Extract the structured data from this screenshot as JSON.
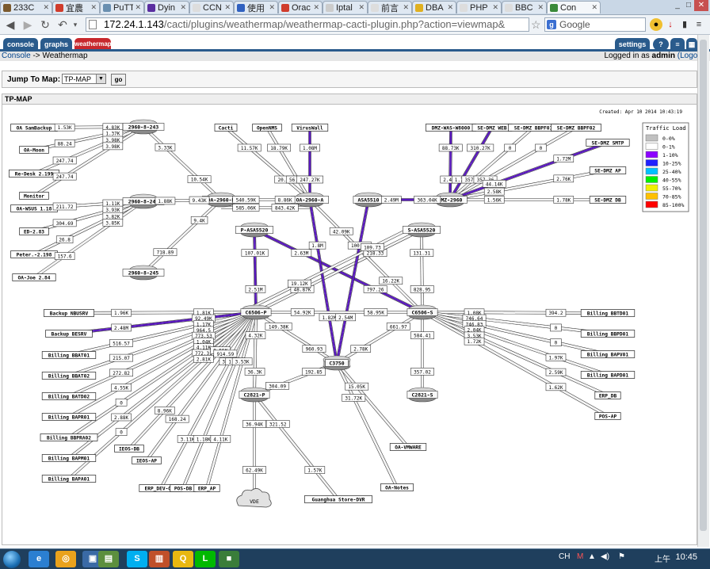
{
  "browser": {
    "tabs": [
      {
        "title": "233C",
        "color": "#7b5a2e"
      },
      {
        "title": "宜農",
        "color": "#d03c2c"
      },
      {
        "title": "PuTT",
        "color": "#6a8fb0"
      },
      {
        "title": "Dyin",
        "color": "#5a2ea0"
      },
      {
        "title": "CCN",
        "color": "#dddddd"
      },
      {
        "title": "使用",
        "color": "#3061c0"
      },
      {
        "title": "Orac",
        "color": "#d03c2c"
      },
      {
        "title": "Iptal",
        "color": "#cccccc"
      },
      {
        "title": "前言",
        "color": "#dddddd"
      },
      {
        "title": "DBA",
        "color": "#e0b020"
      },
      {
        "title": "PHP",
        "color": "#dddddd"
      },
      {
        "title": "BBC",
        "color": "#dddddd"
      },
      {
        "title": "Con",
        "color": "#3a8a3a",
        "active": true
      }
    ],
    "url_host": "172.24.1.143",
    "url_path": "/cacti/plugins/weathermap/weathermap-cacti-plugin.php?action=viewmap&",
    "search_placeholder": "Google",
    "search_g": "g"
  },
  "cacti": {
    "tabs": [
      {
        "label": "console",
        "active": false
      },
      {
        "label": "graphs",
        "active": false
      },
      {
        "label": "weathermap",
        "active": true
      }
    ],
    "settings_label": "settings",
    "breadcrumb_console": "Console",
    "breadcrumb_sep": " -> ",
    "breadcrumb_page": "Weathermap",
    "login_prefix": "Logged in as ",
    "login_user": "admin",
    "logout": "(Logout)",
    "jump_label": "Jump To Map:",
    "jump_selected": "TP-MAP",
    "go_label": "go",
    "map_title": "TP-MAP"
  },
  "map": {
    "created": "Created: Apr 10 2014 10:43:19",
    "legend": {
      "title": "Traffic Load",
      "items": [
        {
          "label": "0-0%",
          "color": "#c0c0c0"
        },
        {
          "label": "0-1%",
          "color": "#ffffff"
        },
        {
          "label": "1-10%",
          "color": "#8c00ff"
        },
        {
          "label": "10-25%",
          "color": "#2020ff"
        },
        {
          "label": "25-40%",
          "color": "#00c0ff"
        },
        {
          "label": "40-55%",
          "color": "#00f000"
        },
        {
          "label": "55-70%",
          "color": "#f0f000"
        },
        {
          "label": "70-85%",
          "color": "#ffc000"
        },
        {
          "label": "85-100%",
          "color": "#ff0000"
        }
      ]
    },
    "nodes": [
      {
        "id": "sw243",
        "label": "2960-8-243",
        "type": "router"
      },
      {
        "id": "sw244",
        "label": "2960-8-244",
        "type": "router"
      },
      {
        "id": "sw245",
        "label": "2960-8-245",
        "type": "router"
      },
      {
        "id": "oa2960b",
        "label": "OA-2960-B",
        "type": "router"
      },
      {
        "id": "oa2960a",
        "label": "OA-2960-A",
        "type": "router"
      },
      {
        "id": "asa5510",
        "label": "ASA5510",
        "type": "router"
      },
      {
        "id": "dmz2960",
        "label": "DMZ-2960",
        "type": "router"
      },
      {
        "id": "pasa",
        "label": "P-ASA5520",
        "type": "router"
      },
      {
        "id": "sasa",
        "label": "S-ASA5520",
        "type": "router"
      },
      {
        "id": "c6506p",
        "label": "C6506-P",
        "type": "router"
      },
      {
        "id": "c6506s",
        "label": "C6506-S",
        "type": "router"
      },
      {
        "id": "c3750",
        "label": "C3750",
        "type": "router"
      },
      {
        "id": "c2821p",
        "label": "C2821-P",
        "type": "router"
      },
      {
        "id": "c2821s",
        "label": "C2821-S",
        "type": "router"
      },
      {
        "id": "cloud",
        "label": "VDE",
        "type": "cloud"
      },
      {
        "id": "oasambackup",
        "label": "OA SamBackup",
        "type": "box"
      },
      {
        "id": "oamoon",
        "label": "OA-Moon",
        "type": "box"
      },
      {
        "id": "redesk",
        "label": "Re-Desk 2.199",
        "type": "box"
      },
      {
        "id": "monitor",
        "label": "Monitor",
        "type": "box"
      },
      {
        "id": "oawsus",
        "label": "OA-WSUS 1.18",
        "type": "box"
      },
      {
        "id": "ed283",
        "label": "ED-2.83",
        "type": "box"
      },
      {
        "id": "peter",
        "label": "Peter.-2.198",
        "type": "box"
      },
      {
        "id": "oajoe",
        "label": "OA-Joe 2.84",
        "type": "box"
      },
      {
        "id": "cacti",
        "label": "Cacti",
        "type": "box"
      },
      {
        "id": "opennms",
        "label": "OpenNMS",
        "type": "box"
      },
      {
        "id": "viruswall",
        "label": "VirusWall",
        "type": "box"
      },
      {
        "id": "dmzwas",
        "label": "DMZ-WAS-W8000",
        "type": "box"
      },
      {
        "id": "sedmzweb",
        "label": "SE-DMZ WEB",
        "type": "box"
      },
      {
        "id": "sedmzbbpf01",
        "label": "SE-DMZ BBPF01",
        "type": "box"
      },
      {
        "id": "sedmzbbpf02",
        "label": "SE-DMZ BBPF02",
        "type": "box"
      },
      {
        "id": "sedmzsmtp",
        "label": "SE-DMZ SMTP",
        "type": "box"
      },
      {
        "id": "sedmzap",
        "label": "SE-DMZ AP",
        "type": "box"
      },
      {
        "id": "sedmzdb",
        "label": "SE-DMZ DB",
        "type": "box"
      },
      {
        "id": "backupnbu",
        "label": "Backup NBUSRV",
        "type": "box"
      },
      {
        "id": "backupbesrv",
        "label": "Backup BESRV",
        "type": "box"
      },
      {
        "id": "bbat01",
        "label": "Billing BBAT01",
        "type": "box"
      },
      {
        "id": "bbat02",
        "label": "Billing BBAT02",
        "type": "box"
      },
      {
        "id": "bbatd02",
        "label": "Billing BATD02",
        "type": "box"
      },
      {
        "id": "bbapr01",
        "label": "Billing BAPR01",
        "type": "box"
      },
      {
        "id": "bbpra02",
        "label": "Billing BBPRA02",
        "type": "box"
      },
      {
        "id": "bbapm01",
        "label": "Billing BAPM01",
        "type": "box"
      },
      {
        "id": "bbapa01",
        "label": "Billing BAPA01",
        "type": "box"
      },
      {
        "id": "ieosdb",
        "label": "IEOS-DB",
        "type": "box"
      },
      {
        "id": "ieosap",
        "label": "IEOS-AP",
        "type": "box"
      },
      {
        "id": "erpdevqas",
        "label": "ERP_DEV-QAS",
        "type": "box"
      },
      {
        "id": "posdb",
        "label": "POS-DB",
        "type": "box"
      },
      {
        "id": "erpap",
        "label": "ERP_AP",
        "type": "box"
      },
      {
        "id": "guanghua",
        "label": "Guanghua Store-DVR",
        "type": "box"
      },
      {
        "id": "oanotes",
        "label": "OA-Notes",
        "type": "box"
      },
      {
        "id": "oavmware",
        "label": "OA-VMWARE",
        "type": "box"
      },
      {
        "id": "bbbtd01",
        "label": "Billing BBTD01",
        "type": "box"
      },
      {
        "id": "bbbpd01",
        "label": "Billing BBPD01",
        "type": "box"
      },
      {
        "id": "bbbpv01",
        "label": "Billing BAPV01",
        "type": "box"
      },
      {
        "id": "bbbpd02",
        "label": "Billing BAPD01",
        "type": "box"
      },
      {
        "id": "erpdb",
        "label": "ERP_DB",
        "type": "box"
      },
      {
        "id": "posap",
        "label": "POS-AP",
        "type": "box"
      }
    ],
    "links": [
      {
        "from": "oasambackup",
        "to": "sw243",
        "a": "1.53K",
        "b": "4.83K"
      },
      {
        "from": "oamoon",
        "to": "sw243",
        "a": "88.24",
        "b": "1.37K"
      },
      {
        "from": "redesk",
        "to": "sw243",
        "a": "247.74",
        "b": "3.98K"
      },
      {
        "from": "monitor",
        "to": "sw243",
        "a": "247.74",
        "b": "3.98K"
      },
      {
        "from": "sw243",
        "to": "oa2960b",
        "a": "3.33K",
        "b": "10.54K"
      },
      {
        "from": "oawsus",
        "to": "sw244",
        "a": "211.72",
        "b": "1.11K"
      },
      {
        "from": "ed283",
        "to": "sw244",
        "a": "304.69",
        "b": "3.93K"
      },
      {
        "from": "peter",
        "to": "sw244",
        "a": "26.8",
        "b": "3.82K"
      },
      {
        "from": "oajoe",
        "to": "sw244",
        "a": "157.6",
        "b": "3.85K"
      },
      {
        "from": "sw244",
        "to": "oa2960b",
        "a": "1.88K",
        "b": "9.43K"
      },
      {
        "from": "sw245",
        "to": "oa2960b",
        "a": "718.89",
        "b": "9.4K"
      },
      {
        "from": "cacti",
        "to": "oa2960a",
        "a": "11.57K",
        "b": "20.97K"
      },
      {
        "from": "opennms",
        "to": "oa2960a",
        "a": "18.79K",
        "b": "56.83K"
      },
      {
        "from": "viruswall",
        "to": "oa2960a",
        "a": "1.08M",
        "b": "247.27K",
        "hot": true
      },
      {
        "from": "oa2960b",
        "to": "oa2960a",
        "a": "540.59K",
        "b": "8.86K"
      },
      {
        "from": "oa2960b",
        "to": "oa2960a",
        "a": "585.06K",
        "b": "843.42K",
        "off": 10
      },
      {
        "from": "asa5510",
        "to": "dmz2960",
        "a": "2.49M",
        "b": "363.04K",
        "hot": true
      },
      {
        "from": "dmzwas",
        "to": "dmz2960",
        "a": "88.73K",
        "b": "2.48M",
        "hot": true
      },
      {
        "from": "sedmzweb",
        "to": "dmz2960",
        "a": "310.27K",
        "b": "1.72M",
        "hot": true
      },
      {
        "from": "sedmzbbpf01",
        "to": "dmz2960",
        "a": "0",
        "b": "357.22"
      },
      {
        "from": "sedmzbbpf02",
        "to": "dmz2960",
        "a": "0",
        "b": "357.36"
      },
      {
        "from": "sedmzsmtp",
        "to": "dmz2960",
        "a": "1.72M",
        "b": "44.14K",
        "hot": true
      },
      {
        "from": "sedmzap",
        "to": "dmz2960",
        "a": "2.76K",
        "b": "2.58K"
      },
      {
        "from": "sedmzdb",
        "to": "dmz2960",
        "a": "1.78K",
        "b": "1.56K"
      },
      {
        "from": "pasa",
        "to": "c6506p",
        "a": "107.01K",
        "b": "2.51M",
        "hot": true
      },
      {
        "from": "pasa",
        "to": "c6506s",
        "a": "2.63M",
        "b": "797.26",
        "hot": true
      },
      {
        "from": "sasa",
        "to": "c6506s",
        "a": "131.31",
        "b": "828.95"
      },
      {
        "from": "sasa",
        "to": "c6506p",
        "a": "218.33",
        "b": "48.87K"
      },
      {
        "from": "oa2960a",
        "to": "c3750",
        "a": "1.8M",
        "b": "1.82M",
        "hot": true
      },
      {
        "from": "oa2960a",
        "to": "c6506s",
        "a": "42.09K",
        "b": "16.22K"
      },
      {
        "from": "asa5510",
        "to": "c3750",
        "a": "100.8K",
        "b": "2.54M",
        "hot": true
      },
      {
        "from": "sasa",
        "to": "c6506p",
        "a": "109.73",
        "b": "19.12K",
        "off": 8
      },
      {
        "from": "c6506p",
        "to": "c6506s",
        "a": "54.92K",
        "b": "58.95K"
      },
      {
        "from": "c6506p",
        "to": "c3750",
        "a": "149.38K",
        "b": "960.93"
      },
      {
        "from": "c6506s",
        "to": "c3750",
        "a": "661.97",
        "b": "2.78K"
      },
      {
        "from": "backupnbu",
        "to": "c6506p",
        "a": "1.96K",
        "b": "1.81K"
      },
      {
        "from": "backupbesrv",
        "to": "c6506p",
        "a": "2.48M",
        "b": "92.49K",
        "hot": true
      },
      {
        "from": "bbat01",
        "to": "c6506p",
        "a": "516.57",
        "b": "1.17K"
      },
      {
        "from": "bbat02",
        "to": "c6506p",
        "a": "215.07",
        "b": "964.5"
      },
      {
        "from": "bbatd02",
        "to": "c6506p",
        "a": "272.82",
        "b": "773.53"
      },
      {
        "from": "bbapr01",
        "to": "c6506p",
        "a": "4.55K",
        "b": "1.04K"
      },
      {
        "from": "bbpra02",
        "to": "c6506p",
        "a": "0",
        "b": "4.11K"
      },
      {
        "from": "bbapm01",
        "to": "c6506p",
        "a": "2.88K",
        "b": "772.31"
      },
      {
        "from": "bbapa01",
        "to": "c6506p",
        "a": "0",
        "b": "2.81K"
      },
      {
        "from": "ieosdb",
        "to": "c6506p",
        "a": "8.96K",
        "b": "8.55K"
      },
      {
        "from": "ieosap",
        "to": "c6506p",
        "a": "168.24",
        "b": "914.59"
      },
      {
        "from": "erpdevqas",
        "to": "c6506p",
        "a": "3.11K",
        "b": "3.06K"
      },
      {
        "from": "posdb",
        "to": "c6506p",
        "a": "1.18K",
        "b": "1.14K"
      },
      {
        "from": "erpap",
        "to": "c6506p",
        "a": "4.11K",
        "b": "3.53K"
      },
      {
        "from": "c6506p",
        "to": "c2821p",
        "a": "4.32K",
        "b": "36.3K"
      },
      {
        "from": "c2821p",
        "to": "c3750",
        "a": "304.09",
        "b": "192.85"
      },
      {
        "from": "c2821p",
        "to": "cloud",
        "a": "36.94K",
        "b": "62.49K"
      },
      {
        "from": "c2821p",
        "to": "guanghua",
        "a": "321.52",
        "b": "1.57K"
      },
      {
        "from": "c3750",
        "to": "oanotes",
        "a": "31.72K",
        "b": ""
      },
      {
        "from": "c3750",
        "to": "oavmware",
        "a": "15.05K",
        "b": ""
      },
      {
        "from": "c6506s",
        "to": "c2821s",
        "a": "584.41",
        "b": "357.02"
      },
      {
        "from": "c6506s",
        "to": "bbbtd01",
        "a": "1.08K",
        "b": "394.2"
      },
      {
        "from": "c6506s",
        "to": "bbbpd01",
        "a": "746.64",
        "b": "0"
      },
      {
        "from": "c6506s",
        "to": "bbbpv01",
        "a": "746.83",
        "b": "0"
      },
      {
        "from": "c6506s",
        "to": "bbbpd02",
        "a": "2.04K",
        "b": "1.97K"
      },
      {
        "from": "c6506s",
        "to": "erpdb",
        "a": "3.53K",
        "b": "2.59K"
      },
      {
        "from": "c6506s",
        "to": "posap",
        "a": "1.72K",
        "b": "1.62K"
      }
    ]
  },
  "taskbar": {
    "icons": [
      {
        "label": "e",
        "color": "#2b7fd1"
      },
      {
        "label": "◎",
        "color": "#e9a21c"
      },
      {
        "label": "▣",
        "color": "#3a6aa5"
      },
      {
        "label": "▤",
        "color": "#5c8f3e"
      },
      {
        "label": "S",
        "color": "#00aff0"
      },
      {
        "label": "▥",
        "color": "#c0502a"
      },
      {
        "label": "Q",
        "color": "#e8b810"
      },
      {
        "label": "L",
        "color": "#00b900"
      },
      {
        "label": "■",
        "color": "#3a7d3a"
      }
    ],
    "lang": "CH",
    "ime": "上午",
    "clock": "10:45"
  }
}
